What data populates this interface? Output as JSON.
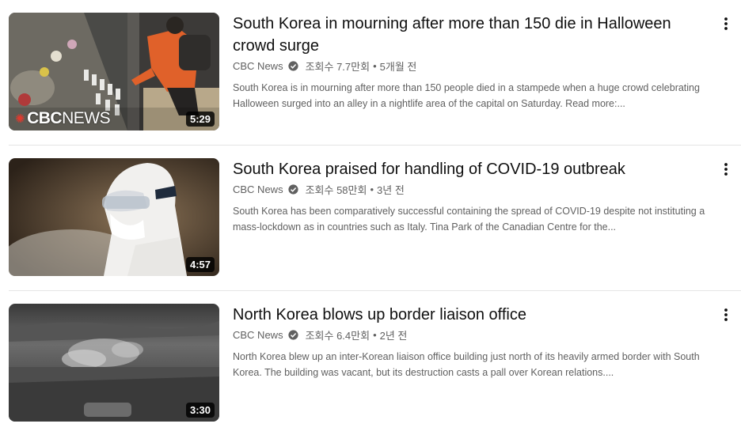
{
  "videos": [
    {
      "title": "South Korea in mourning after more than 150 die in Halloween crowd surge",
      "channel": "CBC News",
      "views": "조회수 7.7만회",
      "age": "5개월 전",
      "description": "South Korea is in mourning after more than 150 people died in a stampede when a huge crowd celebrating Halloween surged into an alley in a nightlife area of the capital on Saturday. Read more:...",
      "duration": "5:29",
      "thumb_brand_bold": "CBC",
      "thumb_brand_light": "NEWS"
    },
    {
      "title": "South Korea praised for handling of COVID-19 outbreak",
      "channel": "CBC News",
      "views": "조회수 58만회",
      "age": "3년 전",
      "description": "South Korea has been comparatively successful containing the spread of COVID-19 despite not instituting a mass-lockdown as in countries such as Italy. Tina Park of the Canadian Centre for the...",
      "duration": "4:57"
    },
    {
      "title": "North Korea blows up border liaison office",
      "channel": "CBC News",
      "views": "조회수 6.4만회",
      "age": "2년 전",
      "description": "North Korea blew up an inter-Korean liaison office building just north of its heavily armed border with South Korea. The building was vacant, but its destruction casts a pall over Korean relations....",
      "duration": "3:30"
    }
  ],
  "separator": "•",
  "icons": {
    "verified": "verified-check-icon",
    "menu": "more-vert-icon",
    "brand": "cbc-gem-icon"
  }
}
